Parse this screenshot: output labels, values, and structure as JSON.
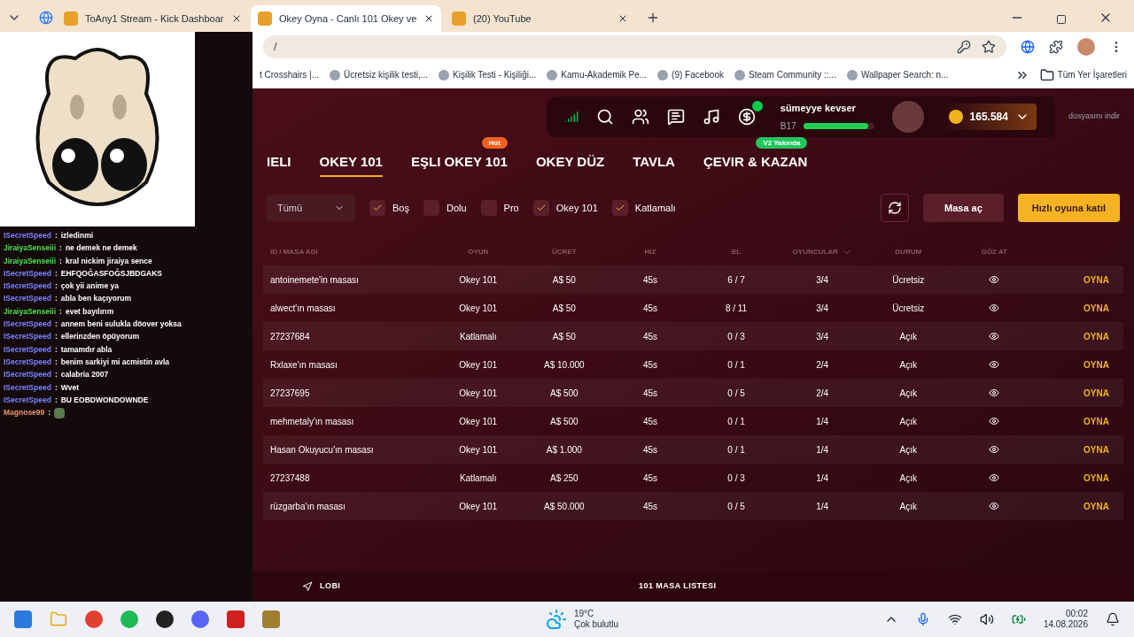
{
  "browser": {
    "tabs": [
      {
        "title": "ToAny1 Stream - Kick Dashboar",
        "selected": false
      },
      {
        "title": "Okey Oyna - Canlı 101 Okey ve",
        "selected": true
      },
      {
        "title": "(20) YouTube",
        "selected": false
      }
    ],
    "address": "/",
    "bookmarks": [
      "t Crosshairs |...",
      "Ücretsiz kişilik testi,...",
      "Kişilik Testi - Kişiliği...",
      "Kamu-Akademik Pe...",
      "(9) Facebook",
      "Steam Community ::...",
      "Wallpaper Search: n..."
    ],
    "all_bookmarks": "Tüm Yer İşaretleri"
  },
  "chat": [
    {
      "user": "ISecretSpeed",
      "sep": ":",
      "text": "izledinmi",
      "color": "#7b83ff"
    },
    {
      "user": "JiraiyaSenseiii",
      "sep": ":",
      "text": "ne demek ne demek",
      "color": "#4ee04e"
    },
    {
      "user": "JiraiyaSenseiii",
      "sep": ":",
      "text": "kral nickim jiraiya sence",
      "color": "#4ee04e"
    },
    {
      "user": "ISecretSpeed",
      "sep": ":",
      "text": "EHFQOĞASFOĞSJBDGAKS",
      "color": "#7b83ff"
    },
    {
      "user": "ISecretSpeed",
      "sep": ":",
      "text": "çok yii anime ya",
      "color": "#7b83ff"
    },
    {
      "user": "ISecretSpeed",
      "sep": ":",
      "text": "abla ben kaçıyorum",
      "color": "#7b83ff"
    },
    {
      "user": "JiraiyaSenseiii",
      "sep": ":",
      "text": "evet bayılırım",
      "color": "#4ee04e"
    },
    {
      "user": "ISecretSpeed",
      "sep": ":",
      "text": "annem beni sulukla döover yoksa",
      "color": "#7b83ff"
    },
    {
      "user": "ISecretSpeed",
      "sep": ":",
      "text": "ellerinzden öpüyorum",
      "color": "#7b83ff"
    },
    {
      "user": "ISecretSpeed",
      "sep": ":",
      "text": "tamamdır abla",
      "color": "#7b83ff"
    },
    {
      "user": "ISecretSpeed",
      "sep": ":",
      "text": "benim sarkiyi mi acmistin avla",
      "color": "#7b83ff"
    },
    {
      "user": "ISecretSpeed",
      "sep": ":",
      "text": "calabria 2007",
      "color": "#7b83ff"
    },
    {
      "user": "ISecretSpeed",
      "sep": ":",
      "text": "Wvet",
      "color": "#7b83ff"
    },
    {
      "user": "ISecretSpeed",
      "sep": ":",
      "text": "BU EOBDWONDOWNDE",
      "color": "#7b83ff"
    },
    {
      "user": "Magnose99",
      "sep": ":",
      "color": "#e8956a"
    }
  ],
  "site": {
    "nav": [
      {
        "label": "IELI",
        "selected": false
      },
      {
        "label": "OKEY 101",
        "selected": true
      },
      {
        "label": "EŞLI OKEY 101",
        "selected": false,
        "badge": {
          "text": "Hot",
          "color": "#f0601e"
        }
      },
      {
        "label": "OKEY DÜZ",
        "selected": false
      },
      {
        "label": "TAVLA",
        "selected": false
      },
      {
        "label": "ÇEVIR & KAZAN",
        "selected": false,
        "badge": {
          "text": "V2 Yakında",
          "color": "#22c55e"
        }
      }
    ],
    "notice": "dosyasını indir",
    "user": {
      "name": "sümeyye kevser",
      "level_label": "B17",
      "level": 0.92,
      "coins": "165.584"
    },
    "filter": {
      "select": "Tümü",
      "checkboxes": [
        {
          "label": "Boş",
          "checked": true
        },
        {
          "label": "Dolu",
          "checked": false
        },
        {
          "label": "Pro",
          "checked": false
        },
        {
          "label": "Okey 101",
          "checked": true
        },
        {
          "label": "Katlamalı",
          "checked": true
        }
      ],
      "open_button": "Masa aç",
      "quick_button": "Hızlı oyuna katıl"
    },
    "table": {
      "columns": [
        "ID / MASA ADI",
        "OYUN",
        "ÜCRET",
        "HIZ",
        "EL",
        "OYUNCULAR",
        "DURUM",
        "GÖZ AT"
      ],
      "rows": [
        [
          "antoinemete'in masası",
          "Okey 101",
          "A$  50",
          "45s",
          "6 / 7",
          "3/4",
          "Ücretsiz",
          "OYNA"
        ],
        [
          "alwect'ın masası",
          "Okey 101",
          "A$  50",
          "45s",
          "8 / 11",
          "3/4",
          "Ücretsiz",
          "OYNA"
        ],
        [
          "27237684",
          "Katlamalı",
          "A$  50",
          "45s",
          "0 / 3",
          "3/4",
          "Açık",
          "OYNA"
        ],
        [
          "Rxlaxe'ın masası",
          "Okey 101",
          "A$  10.000",
          "45s",
          "0 / 1",
          "2/4",
          "Açık",
          "OYNA"
        ],
        [
          "27237695",
          "Okey 101",
          "A$  500",
          "45s",
          "0 / 5",
          "2/4",
          "Açık",
          "OYNA"
        ],
        [
          "mehmetaly'ın masası",
          "Okey 101",
          "A$  500",
          "45s",
          "0 / 1",
          "1/4",
          "Açık",
          "OYNA"
        ],
        [
          "Hasan Okuyucu'ın masası",
          "Okey 101",
          "A$  1.000",
          "45s",
          "0 / 1",
          "1/4",
          "Açık",
          "OYNA"
        ],
        [
          "27237488",
          "Katlamalı",
          "A$  250",
          "45s",
          "0 / 3",
          "1/4",
          "Açık",
          "OYNA"
        ],
        [
          "rüzgarba'ın masası",
          "Okey 101",
          "A$  50.000",
          "45s",
          "0 / 5",
          "1/4",
          "Açık",
          "OYNA"
        ]
      ]
    },
    "footer": {
      "left": "LOBI",
      "center": "101 MASA LISTESI"
    }
  },
  "taskbar": {
    "temperature": "19°C",
    "weather": "Çok bulutlu",
    "time": "00:02",
    "date": "14.08.2026"
  }
}
